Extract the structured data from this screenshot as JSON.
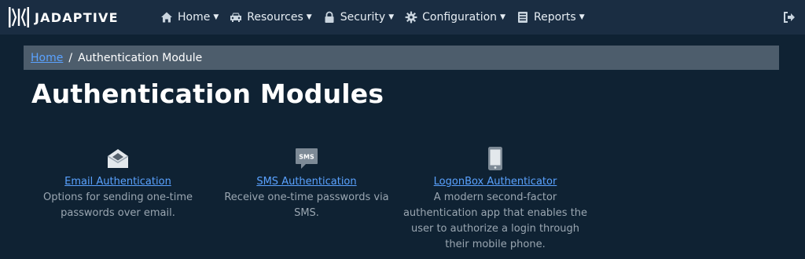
{
  "brand": {
    "name": "JADAPTIVE",
    "logo_icon": "jadaptive-logo-icon"
  },
  "nav": {
    "items": [
      {
        "label": "Home",
        "icon": "home-icon"
      },
      {
        "label": "Resources",
        "icon": "car-icon"
      },
      {
        "label": "Security",
        "icon": "lock-icon"
      },
      {
        "label": "Configuration",
        "icon": "gear-icon"
      },
      {
        "label": "Reports",
        "icon": "report-icon"
      }
    ],
    "logout_icon": "sign-out-icon"
  },
  "breadcrumb": {
    "home": "Home",
    "separator": "/",
    "current": "Authentication Module"
  },
  "page": {
    "title": "Authentication Modules"
  },
  "modules": [
    {
      "icon": "envelope-open-icon",
      "title": "Email Authentication",
      "description_lines": [
        "Options for sending one-time",
        "passwords over email."
      ]
    },
    {
      "icon": "sms-icon",
      "icon_text": "SMS",
      "title": "SMS Authentication",
      "description_lines": [
        "Receive one-time passwords via",
        "SMS."
      ]
    },
    {
      "icon": "mobile-phone-icon",
      "title": "LogonBox Authenticator",
      "description_lines": [
        "A modern second-factor",
        "authentication app that enables the",
        "user to authorize a login through",
        "their mobile phone."
      ]
    }
  ],
  "colors": {
    "background": "#0f2233",
    "navbar": "#1a2d42",
    "breadcrumb_bg": "#4d5d6c",
    "link": "#5aa2ff",
    "muted_text": "#9aa6b1"
  }
}
